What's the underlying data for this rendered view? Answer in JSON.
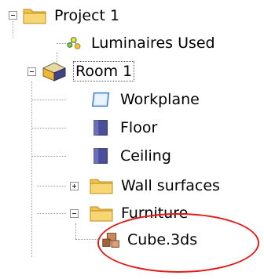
{
  "tree": {
    "project": {
      "label": "Project 1",
      "icon": "folder-icon",
      "expanded": true
    },
    "luminaires": {
      "label": "Luminaires Used",
      "icon": "luminaires-icon"
    },
    "room": {
      "label": "Room 1",
      "icon": "room-box-icon",
      "expanded": true,
      "selected": true
    },
    "workplane": {
      "label": "Workplane",
      "icon": "workplane-icon"
    },
    "floor": {
      "label": "Floor",
      "icon": "surface-icon"
    },
    "ceiling": {
      "label": "Ceiling",
      "icon": "surface-icon"
    },
    "wall_surfaces": {
      "label": "Wall surfaces",
      "icon": "folder-icon",
      "expanded": false
    },
    "furniture": {
      "label": "Furniture",
      "icon": "folder-icon",
      "expanded": true
    },
    "cube": {
      "label": "Cube.3ds",
      "icon": "object-3ds-icon"
    }
  },
  "colors": {
    "highlight_oval": "#e21b1b",
    "folder": "#f2c34b",
    "surface": "#4b4f9a"
  }
}
